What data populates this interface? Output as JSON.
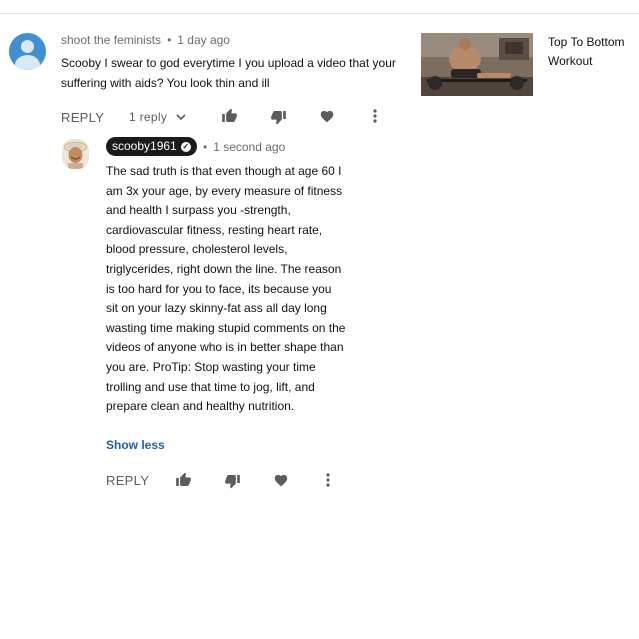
{
  "comment": {
    "author": "shoot the feminists",
    "time": "1 day ago",
    "text": "Scooby I swear to god everytime I you upload a video that your suffering with aids?  You look thin and ill",
    "reply_label": "REPLY",
    "replies_toggle": "1 reply"
  },
  "reply": {
    "author": "scooby1961",
    "time": "1 second ago",
    "text": "The sad truth is that even though at age 60 I am 3x your age, by every measure of fitness and health I surpass you -strength,  cardiovascular fitness,  resting heart rate, blood pressure, cholesterol levels, triglycerides, right down the line.  The reason is too hard for you to face, its because you sit on your lazy skinny-fat ass all day long wasting time making stupid comments on the videos of anyone who is in better shape than you are.  ProTip: Stop wasting your time trolling and use that time to jog, lift, and prepare clean and healthy nutrition.",
    "show_less": "Show less",
    "reply_label": "REPLY"
  },
  "related_video": {
    "title": "Top To Bottom Workout"
  },
  "icons": {
    "like": "thumbs-up-icon",
    "dislike": "thumbs-down-icon",
    "heart": "heart-icon",
    "more": "more-vert-icon",
    "chevron": "chevron-down-icon",
    "verified": "verified-check-icon"
  },
  "colors": {
    "avatar_default": "#3f8fd2",
    "link": "#1f5fa6",
    "badge_bg": "#1b1b1b",
    "meta_text": "#6b6b6b"
  }
}
